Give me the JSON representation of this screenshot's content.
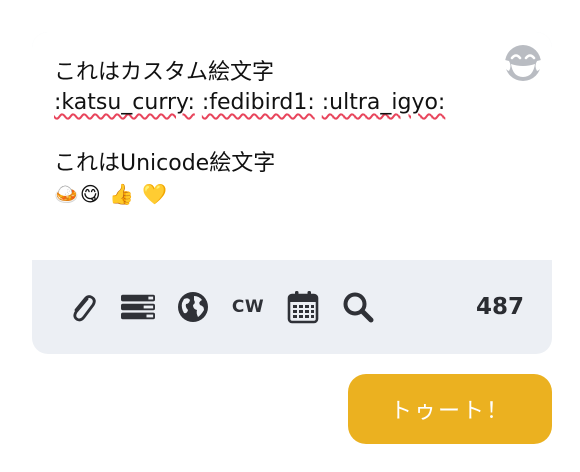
{
  "compose": {
    "lines": {
      "l1": "これはカスタム絵文字",
      "sc1": ":katsu_curry:",
      "sc2": ":fedibird1:",
      "sc3": ":ultra_igyo:",
      "l3": "これはUnicode絵文字",
      "emojis": "🍛😋 👍 💛"
    },
    "emoji_picker_icon": "laughing-face-icon"
  },
  "toolbar": {
    "cw_label": "CW",
    "char_counter": "487",
    "icons": [
      "paperclip-icon",
      "poll-icon",
      "globe-icon",
      "cw",
      "calendar-icon",
      "search-icon"
    ]
  },
  "submit": {
    "label": "トゥート！"
  },
  "colors": {
    "accent": "#ebb120",
    "toolbar_bg": "#eceff4",
    "icon": "#2f3137",
    "spellcheck": "#e8455c"
  }
}
